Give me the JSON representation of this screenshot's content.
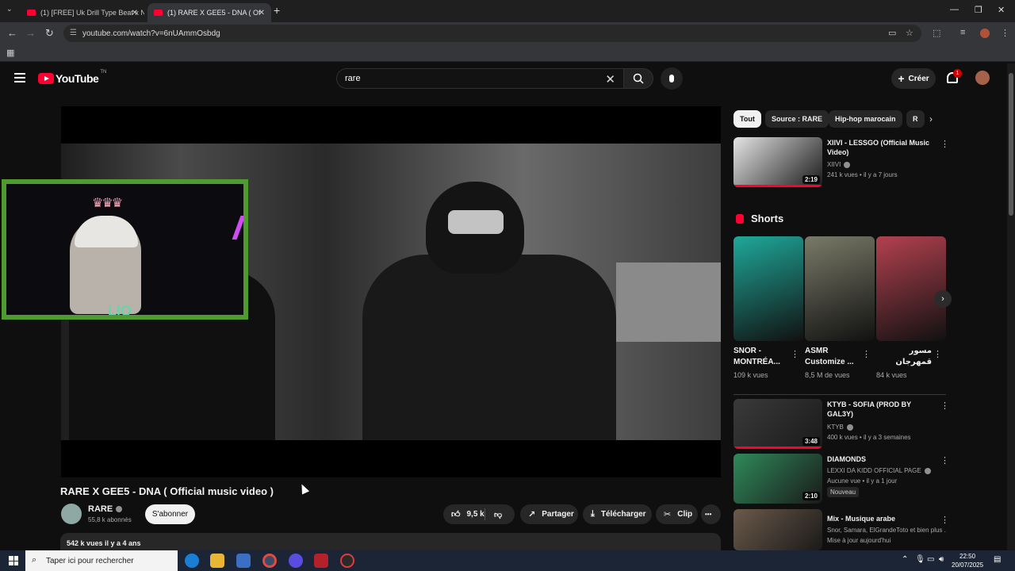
{
  "browser": {
    "tabs": [
      {
        "label": "(1) [FREE] Uk Drill Type Beat x N",
        "close": "✕"
      },
      {
        "label": "(1) RARE X GEE5 - DNA ( Of",
        "close": "✕"
      }
    ],
    "new_tab": "+",
    "url": "youtube.com/watch?v=6nUAmmOsbdg",
    "window_controls": [
      "—",
      "❐",
      "✕"
    ]
  },
  "youtube": {
    "logo_text": "YouTube",
    "logo_region": "TN",
    "search": {
      "value": "rare",
      "clear": "✕"
    },
    "create_label": "Créer",
    "create_plus": "+",
    "notif_count": "1"
  },
  "video": {
    "title": "RARE X GEE5 - DNA ( Official music video )",
    "overlay_text": "LIO",
    "channel": {
      "name": "RARE",
      "subscribers": "55,8 k abonnés"
    },
    "subscribe_label": "S'abonner",
    "likes": "9,5 k",
    "share_label": "Partager",
    "download_label": "Télécharger",
    "clip_label": "Clip",
    "more": "•••",
    "description_meta": "542 k vues  il y a 4 ans"
  },
  "sidebar": {
    "chips": [
      {
        "label": "Tout",
        "active": true
      },
      {
        "label": "Source : RARE",
        "active": false
      },
      {
        "label": "Hip-hop marocain",
        "active": false
      },
      {
        "label": "R",
        "active": false
      }
    ],
    "next_videos": [
      {
        "title": "XIIVI - LESSGO (Official Music Video)",
        "channel": "XIIVI",
        "meta": "241 k vues • il y a 7 jours",
        "duration": "2:19",
        "progress": 1.0,
        "color": "#e5e5e5"
      },
      {
        "title": "KTYB - SOFIA (PROD BY GAL3Y)",
        "channel": "KTYB",
        "meta": "400 k vues • il y a 3 semaines",
        "duration": "3:48",
        "progress": 1.0,
        "color": "#3a3a3a"
      },
      {
        "title": "DIAMONDS",
        "channel": "LEXXI DA KIDD OFFICIAL PAGE",
        "meta": "Aucune vue • il y a 1 jour",
        "duration": "2:10",
        "progress": 0,
        "badge": "Nouveau",
        "color": "#2f8a5a"
      },
      {
        "title": "Mix - Musique arabe",
        "channel": "Snor, Samara, ElGrandeToto et bien plus ...",
        "meta": "Mise à jour aujourd'hui",
        "duration": "",
        "progress": 0,
        "color": "#6b5a4a"
      }
    ],
    "shorts_title": "Shorts",
    "shorts": [
      {
        "title": "SNOR - MONTRÉA...",
        "views": "109 k vues",
        "color": "#1fa89a"
      },
      {
        "title": "ASMR Customize ...",
        "views": "8,5 M de vues",
        "color": "#7a7a68"
      },
      {
        "title": "مسور قمهرجان الكبير بالرباط🤍...",
        "views": "84 k vues",
        "color": "#b3414f"
      }
    ]
  },
  "taskbar": {
    "search_placeholder": "Taper ici pour rechercher",
    "time": "22:50",
    "date": "20/07/2025"
  }
}
